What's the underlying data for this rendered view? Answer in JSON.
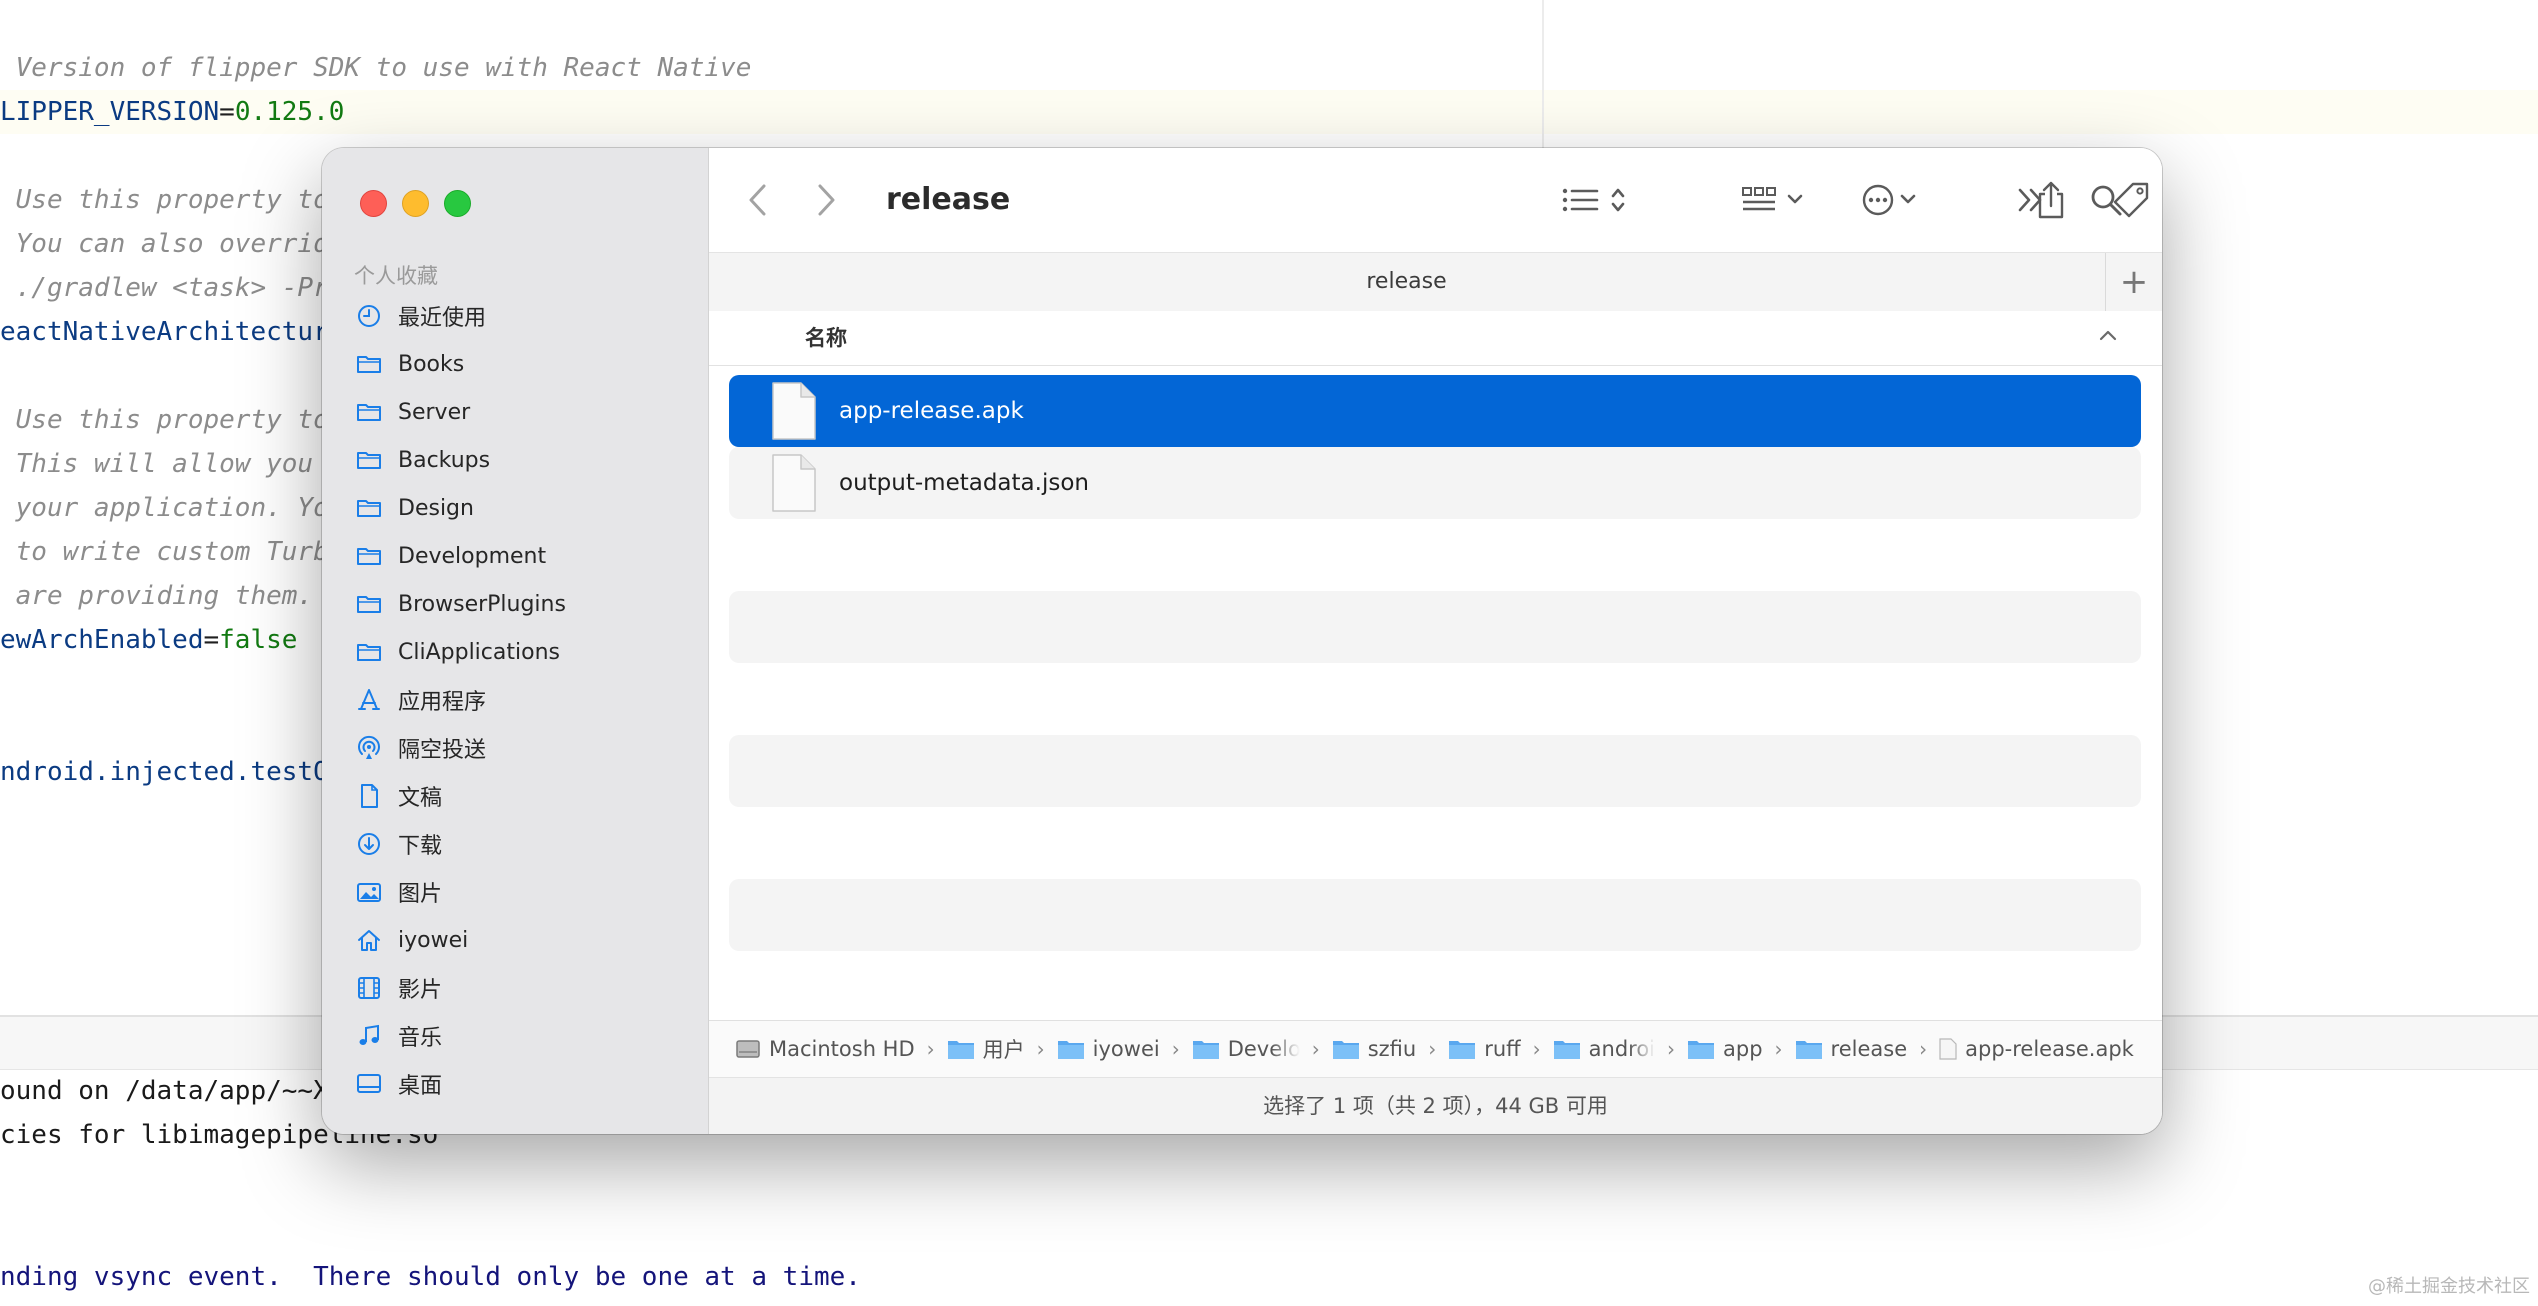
{
  "editor": {
    "lines": [
      {
        "type": "comment",
        "text": " Version of flipper SDK to use with React Native"
      },
      {
        "type": "prop",
        "key": "LIPPER_VERSION",
        "value": "0.125.0"
      },
      {
        "type": "comment",
        "text": " Use this property to"
      },
      {
        "type": "comment",
        "text": " You can also overrid"
      },
      {
        "type": "comment",
        "text": " ./gradlew <task> -Pr"
      },
      {
        "type": "plain",
        "text": "eactNativeArchitectur"
      },
      {
        "type": "comment",
        "text": " Use this property to"
      },
      {
        "type": "comment",
        "text": " This will allow you"
      },
      {
        "type": "comment",
        "text": " your application. Yo"
      },
      {
        "type": "comment",
        "text": " to write custom Turb"
      },
      {
        "type": "comment",
        "text": " are providing them."
      },
      {
        "type": "prop",
        "key": "ewArchEnabled",
        "value": "false"
      },
      {
        "type": "plain",
        "text": "ndroid.injected.testO"
      }
    ]
  },
  "console": {
    "lines": [
      "ound on /data/app/~~Xw",
      "cies for libimagepipeline.so",
      "nding vsync event.  There should only be one at a time."
    ]
  },
  "finder": {
    "title": "release",
    "tab_label": "release",
    "tab_add": "+",
    "column_name": "名称",
    "sidebar": {
      "header": "个人收藏",
      "items": [
        {
          "label": "最近使用",
          "icon": "clock-icon"
        },
        {
          "label": "Books",
          "icon": "folder-icon"
        },
        {
          "label": "Server",
          "icon": "folder-icon"
        },
        {
          "label": "Backups",
          "icon": "folder-icon"
        },
        {
          "label": "Design",
          "icon": "folder-icon"
        },
        {
          "label": "Development",
          "icon": "folder-icon"
        },
        {
          "label": "BrowserPlugins",
          "icon": "folder-icon"
        },
        {
          "label": "CliApplications",
          "icon": "folder-icon"
        },
        {
          "label": "应用程序",
          "icon": "applications-icon"
        },
        {
          "label": "隔空投送",
          "icon": "airdrop-icon"
        },
        {
          "label": "文稿",
          "icon": "document-icon"
        },
        {
          "label": "下载",
          "icon": "download-icon"
        },
        {
          "label": "图片",
          "icon": "photo-icon"
        },
        {
          "label": "iyowei",
          "icon": "home-icon"
        },
        {
          "label": "影片",
          "icon": "film-icon"
        },
        {
          "label": "音乐",
          "icon": "music-icon"
        },
        {
          "label": "桌面",
          "icon": "desktop-icon"
        }
      ]
    },
    "files": [
      {
        "name": "app-release.apk",
        "selected": true
      },
      {
        "name": "output-metadata.json",
        "selected": false
      }
    ],
    "path": [
      "Macintosh HD",
      "用户",
      "iyowei",
      "Develo",
      "szfiu",
      "ruff",
      "androi",
      "app",
      "release",
      "app-release.apk"
    ],
    "status": "选择了 1 项（共 2 项），44 GB 可用",
    "colors": {
      "selection": "#0366d6",
      "accent": "#1a7ee8"
    }
  },
  "watermark": "@稀土掘金技术社区"
}
